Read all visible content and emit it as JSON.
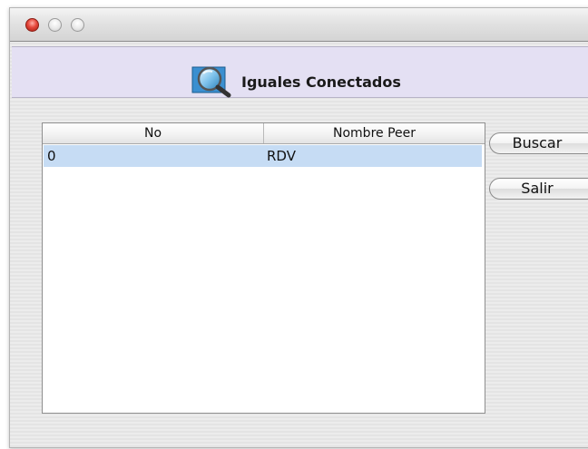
{
  "window": {
    "controls": [
      "close-button",
      "minimize-button",
      "zoom-button"
    ]
  },
  "header": {
    "icon": "magnifier-icon",
    "title": "Iguales Conectados"
  },
  "table": {
    "columns": [
      "No",
      "Nombre Peer"
    ],
    "rows": [
      [
        "0",
        "RDV"
      ]
    ],
    "selected_row": 0
  },
  "buttons": {
    "search_label": "Buscar",
    "exit_label": "Salir"
  },
  "colors": {
    "header_band": "#e4e0f3",
    "selection": "#c6dcf4",
    "close_light": "#e5473b"
  }
}
